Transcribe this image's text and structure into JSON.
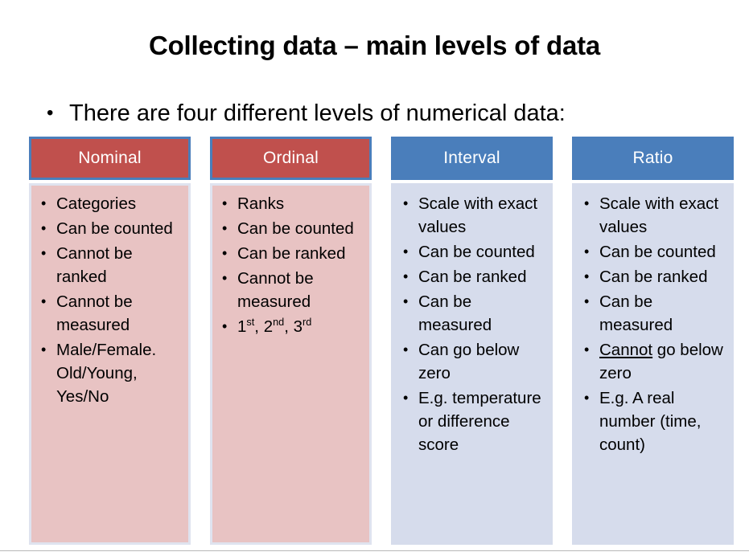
{
  "slide": {
    "title": "Collecting data – main levels of data",
    "subtitle_bullet": "•",
    "subtitle": "There are four different levels of numerical data:"
  },
  "colors": {
    "header_red": "#c0504d",
    "header_blue": "#4a7ebb",
    "body_pink": "#e8c3c3",
    "body_light_blue": "#d6dcec",
    "header_border": "#4a7ebb",
    "rule": "#b7b7b7",
    "text": "#000000",
    "header_text": "#ffffff"
  },
  "columns": [
    {
      "header": "Nominal",
      "header_style": "red",
      "body_style": "pink",
      "items": [
        {
          "text": "Categories"
        },
        {
          "text": "Can be counted"
        },
        {
          "text": "Cannot be ranked"
        },
        {
          "text": "Cannot be measured"
        },
        {
          "text": "Male/Female. Old/Young, Yes/No"
        }
      ]
    },
    {
      "header": "Ordinal",
      "header_style": "red",
      "body_style": "pink",
      "items": [
        {
          "text": "Ranks"
        },
        {
          "text": "Can be counted"
        },
        {
          "text": "Can be ranked"
        },
        {
          "text": "Cannot be measured"
        },
        {
          "text": "1st, 2nd, 3rd",
          "html": "1<sup>st</sup>, 2<sup>nd</sup>, 3<sup>rd</sup>"
        }
      ]
    },
    {
      "header": "Interval",
      "header_style": "blue",
      "body_style": "lblue",
      "items": [
        {
          "text": "Scale with exact values"
        },
        {
          "text": "Can be counted"
        },
        {
          "text": "Can be ranked"
        },
        {
          "text": "Can be measured"
        },
        {
          "text": "Can go below zero"
        },
        {
          "text": "E.g. temperature or difference score"
        }
      ]
    },
    {
      "header": "Ratio",
      "header_style": "blue",
      "body_style": "lblue",
      "items": [
        {
          "text": "Scale with exact values"
        },
        {
          "text": "Can be counted"
        },
        {
          "text": "Can be ranked"
        },
        {
          "text": "Can be measured"
        },
        {
          "text": "Cannot go below zero",
          "html": "<span class=\"u\">Cannot</span> go below zero"
        },
        {
          "text": "E.g. A real number (time, count)"
        }
      ]
    }
  ]
}
